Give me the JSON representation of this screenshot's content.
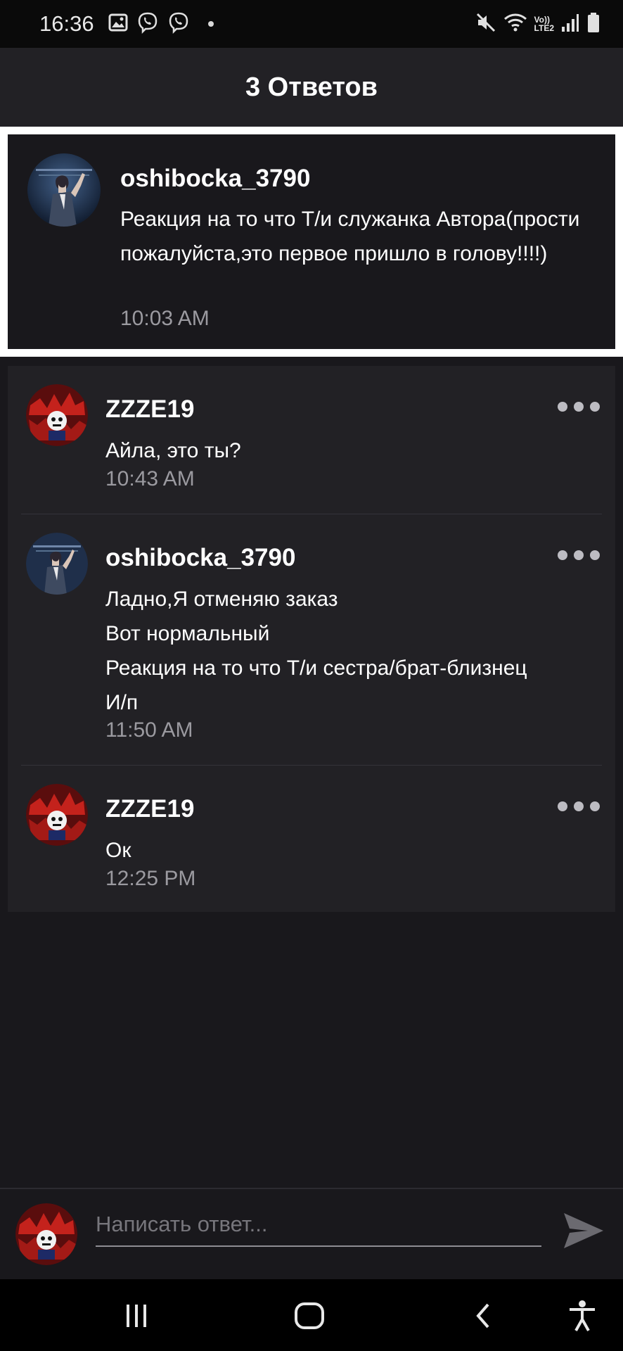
{
  "status_bar": {
    "time": "16:36",
    "network_label_top": "Vo))",
    "network_label_bottom": "LTE2"
  },
  "header": {
    "title": "3 Ответов"
  },
  "original_post": {
    "author": "oshibocka_3790",
    "text": "Реакция на то что Т/и служанка Автора(прости пожалуйста,это первое пришло в голову!!!!)",
    "time": "10:03 AM"
  },
  "replies": [
    {
      "author": "ZZZE19",
      "text": "Айла, это ты?",
      "time": "10:43 AM"
    },
    {
      "author": "oshibocka_3790",
      "lines": [
        "Ладно,Я отменяю заказ",
        "Вот нормальный",
        "Реакция на то что Т/и сестра/брат-близнец",
        "И/п"
      ],
      "time": "11:50 AM"
    },
    {
      "author": "ZZZE19",
      "text": "Ок",
      "time": "12:25 PM"
    }
  ],
  "input": {
    "placeholder": "Написать ответ..."
  },
  "icons": {
    "status": [
      "gallery-icon",
      "viber-icon",
      "viber-icon",
      "mute-icon",
      "wifi-icon",
      "signal-icon",
      "battery-icon"
    ],
    "reply_menu": "more-icon",
    "send": "send-icon",
    "nav": [
      "recent-apps-icon",
      "home-icon",
      "back-icon",
      "accessibility-icon"
    ]
  },
  "colors": {
    "background": "#19181c",
    "header": "#222125",
    "highlight_border": "#ffffff",
    "muted_text": "#9b9aa0"
  }
}
